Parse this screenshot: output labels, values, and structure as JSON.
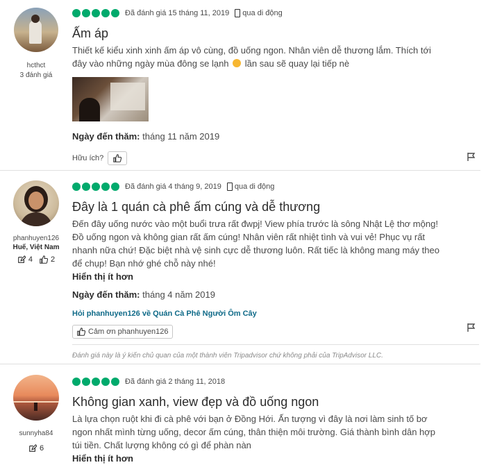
{
  "reviews": [
    {
      "username": "hcthct",
      "contributions": "3 đánh giá",
      "rated_text": "Đã đánh giá 15 tháng 11, 2019",
      "via": "qua di động",
      "title": "Ấm áp",
      "body_line1": "Thiết kế kiểu xinh xinh ấm áp vô cùng, đồ uống ngon. Nhân viên dễ thương lắm. Thích tới",
      "body_line2a": "đây vào những ngày mùa đông se lạnh",
      "body_line2b": "lần sau sẽ quay lại tiếp nè",
      "visit_label": "Ngày đến thăm:",
      "visit_value": "tháng 11 năm 2019",
      "helpful_label": "Hữu ích?"
    },
    {
      "username": "phanhuyen126",
      "location": "Huế, Việt Nam",
      "review_count": "4",
      "helpful_count": "2",
      "rated_text": "Đã đánh giá 4 tháng 9, 2019",
      "via": "qua di động",
      "title": "Đây là 1 quán cà phê ấm cúng và dễ thương",
      "body_lines": [
        "Đến đây uống nước vào một buổi trưa rất đwpj! View phía trước là sông Nhật Lệ thơ mộng!",
        "Đồ uống ngon và không gian rất ấm cúng! Nhân viên rất nhiệt tình và vui vẻ! Phục vụ rất",
        "nhanh nữa chứ! Đặc biệt nhà vệ sinh cực dễ thương luôn. Rất tiếc là không mang máy theo",
        "để chụp! Bạn nhớ ghé chỗ này nhé!"
      ],
      "show_less": "Hiển thị ít hơn",
      "visit_label": "Ngày đến thăm:",
      "visit_value": "tháng 4 năm 2019",
      "ask_link": "Hỏi phanhuyen126 về Quán Cà Phê Người Ôm Cây",
      "thanks_label": "Cảm ơn phanhuyen126",
      "disclaimer": "Đánh giá này là ý kiến chủ quan của một thành viên Tripadvisor chứ không phải của TripAdvisor LLC."
    },
    {
      "username": "sunnyha84",
      "review_count": "6",
      "rated_text": "Đã đánh giá 2 tháng 11, 2018",
      "title": "Không gian xanh, view đẹp và đồ uống ngon",
      "body_lines": [
        "Là lựa chọn ruột khi đi cà phê với bạn ở Đồng Hới. Ấn tượng vì đây là nơi làm sinh tố bơ",
        "ngon nhất mình từng uống, decor ấm cúng, thân thiện môi trường. Giá thành bình dân hợp",
        "túi tiền. Chất lượng không có gì để phàn nàn"
      ],
      "show_less": "Hiển thị ít hơn"
    }
  ],
  "colors": {
    "bubble": "#00aa6c",
    "link": "#0f6a88"
  },
  "icons": [
    "mobile-icon",
    "thumbs-up-icon",
    "flag-icon",
    "edit-icon",
    "smile-emoji-icon"
  ]
}
